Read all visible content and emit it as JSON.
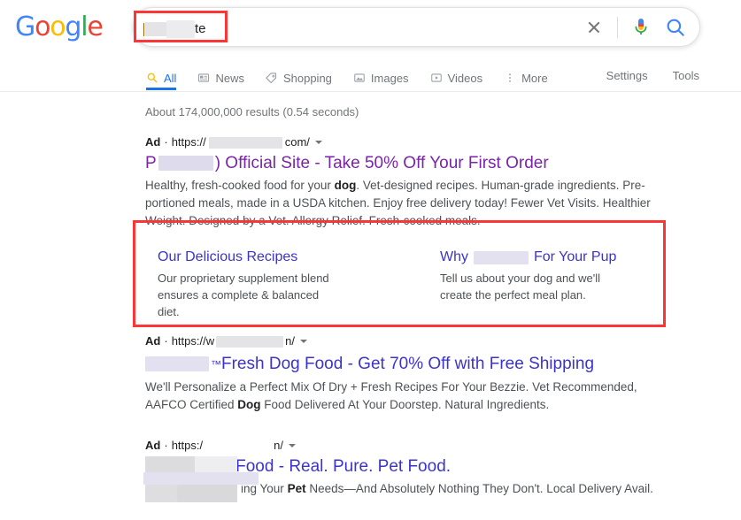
{
  "brand": {
    "logo_letters": [
      {
        "ch": "G",
        "color": "#4285f4"
      },
      {
        "ch": "o",
        "color": "#ea4335"
      },
      {
        "ch": "o",
        "color": "#fbbc05"
      },
      {
        "ch": "g",
        "color": "#4285f4"
      },
      {
        "ch": "l",
        "color": "#34a853"
      },
      {
        "ch": "e",
        "color": "#ea4335"
      }
    ],
    "logo_text": "Google"
  },
  "colors": {
    "accent_blue": "#1a73e8",
    "highlight_red": "#fc3535",
    "visited_purple": "#7b24a8",
    "link_blue": "#3c34c9",
    "muted_gray": "#70757a",
    "redaction_gray": "#e4e4e6",
    "redaction_lavender": "#dedbec"
  },
  "search": {
    "query_visible_suffix": "te",
    "query_redacted": true,
    "clear_label": "Clear",
    "mic_label": "Search by voice",
    "search_label": "Google Search"
  },
  "tabs": [
    {
      "id": "all",
      "label": "All",
      "icon": "search-icon",
      "active": true
    },
    {
      "id": "news",
      "label": "News",
      "icon": "news-icon",
      "active": false
    },
    {
      "id": "shopping",
      "label": "Shopping",
      "icon": "tag-icon",
      "active": false
    },
    {
      "id": "images",
      "label": "Images",
      "icon": "image-icon",
      "active": false
    },
    {
      "id": "videos",
      "label": "Videos",
      "icon": "video-icon",
      "active": false
    },
    {
      "id": "more",
      "label": "More",
      "icon": "more-vertical-icon",
      "active": false
    }
  ],
  "toolbar": {
    "settings_label": "Settings",
    "tools_label": "Tools"
  },
  "result_stats": "About 174,000,000 results (0.54 seconds)",
  "ads": [
    {
      "badge": "Ad",
      "separator": "·",
      "url_scheme": "https://",
      "url_suffix": "com/",
      "url_redacted": true,
      "title_prefix": "P",
      "title_suffix": ") Official Site - Take 50% Off Your First Order",
      "title_visited": true,
      "desc_line1_a": "Healthy, fresh-cooked food for your ",
      "desc_bold1": "dog",
      "desc_line1_b": ". Vet-designed recipes. Human-grade ingredients. Pre-",
      "desc_line2": "portioned meals, made in a USDA kitchen. Enjoy free delivery today! Fewer Vet Visits. Healthier",
      "desc_line3": "Weight. Designed by a Vet. Allergy Relief. Fresh-cooked meals.",
      "highlighted": true
    },
    {
      "badge": "Ad",
      "separator": "·",
      "url_scheme": "https://w",
      "url_suffix": "n/",
      "url_redacted": true,
      "title_prefix": "",
      "title_trademark": "™",
      "title_suffix": " Fresh Dog Food - Get 70% Off with Free Shipping",
      "title_visited": false,
      "desc_line1": "We'll Personalize a Perfect Mix Of Dry + Fresh Recipes For Your Bezzie. Vet Recommended,",
      "desc_line2_a": "AAFCO Certified ",
      "desc_bold2": "Dog",
      "desc_line2_b": " Food Delivered At Your Doorstep. Natural Ingredients.",
      "highlighted": false
    },
    {
      "badge": "Ad",
      "separator": "·",
      "url_scheme": "https:/",
      "url_suffix": "n/",
      "url_redacted": true,
      "title_prefix": "",
      "title_suffix": "Dog Food - Real. Pure. Pet Food.",
      "title_visited": false,
      "desc_line1_a": "ing Your ",
      "desc_bold1": "Pet",
      "desc_line1_b": " Needs—And Absolutely Nothing They Don't. Local Delivery Avail.",
      "highlighted": false
    }
  ],
  "sitelinks": [
    {
      "title_prefix": "Our Delicious Recipes",
      "title_suffix": "",
      "redacted": false,
      "desc_line1": "Our proprietary supplement blend",
      "desc_line2": "ensures a complete & balanced diet."
    },
    {
      "title_prefix": "Why",
      "title_suffix": "For Your Pup",
      "redacted": true,
      "desc_line1": "Tell us about your dog and we'll",
      "desc_line2": "create the perfect meal plan."
    }
  ]
}
